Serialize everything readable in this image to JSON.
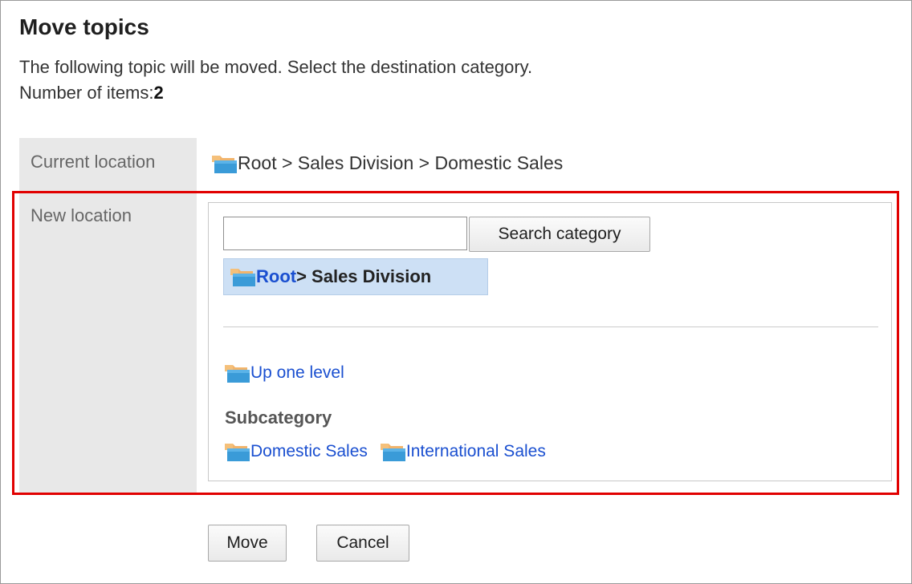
{
  "dialog": {
    "title": "Move topics",
    "description": "The following topic will be moved. Select the destination category.",
    "item_count_label": "Number of items:",
    "item_count": "2"
  },
  "current_location": {
    "label": "Current location",
    "path": "Root > Sales Division > Domestic Sales"
  },
  "new_location": {
    "label": "New location",
    "search": {
      "value": "",
      "placeholder": "",
      "button_label": "Search category"
    },
    "selected": {
      "root": "Root",
      "rest": " > Sales Division"
    },
    "up_one_level": "Up one level",
    "subcategory_heading": "Subcategory",
    "subcategories": [
      "Domestic Sales",
      "International Sales"
    ]
  },
  "actions": {
    "move_label": "Move",
    "cancel_label": "Cancel"
  },
  "colors": {
    "highlight_border": "#e10000",
    "link": "#1a4fd0",
    "selected_bg": "#cde0f5",
    "label_bg": "#e8e8e8"
  },
  "icons": {
    "folder": "folder-icon"
  }
}
